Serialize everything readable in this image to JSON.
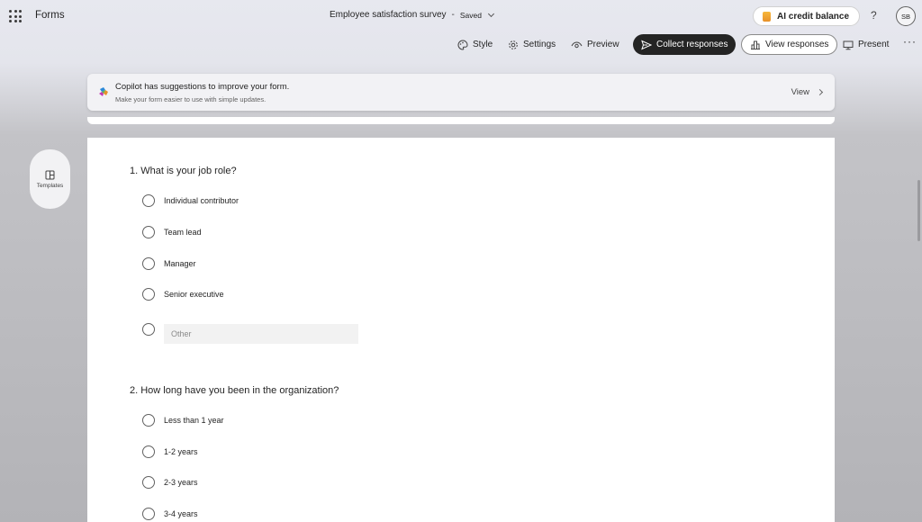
{
  "header": {
    "app_name": "Forms",
    "form_title": "Employee satisfaction survey",
    "separator": "-",
    "status": "Saved",
    "ai_credit_label": "AI credit balance",
    "help_label": "?",
    "user_initials": "SB"
  },
  "toolbar": {
    "style": "Style",
    "settings": "Settings",
    "preview": "Preview",
    "collect": "Collect responses",
    "view_responses": "View responses",
    "present": "Present",
    "more": "···"
  },
  "copilot": {
    "title": "Copilot has suggestions to improve your form.",
    "subtitle": "Make your form easier to use with simple updates.",
    "view": "View"
  },
  "side": {
    "templates": "Templates"
  },
  "questions": [
    {
      "title": "1. What is your job role?",
      "options": [
        "Individual contributor",
        "Team lead",
        "Manager",
        "Senior executive"
      ],
      "other_placeholder": "Other"
    },
    {
      "title": "2. How long have you been in the organization?",
      "options": [
        "Less than 1 year",
        "1-2 years",
        "2-3 years",
        "3-4 years"
      ]
    }
  ],
  "colors": {
    "primary_button": "#242424",
    "card": "#ffffff",
    "background_top": "#e7e8ef"
  }
}
